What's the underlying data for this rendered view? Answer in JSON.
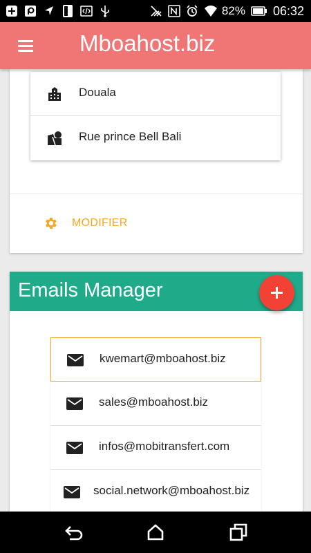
{
  "status_bar": {
    "battery_percent": "82%",
    "time": "06:32",
    "icons": [
      "plus-icon",
      "rounded-square-icon",
      "navigation-icon",
      "phone-icon",
      "code-icon",
      "usb-icon",
      "signal-off-icon",
      "nfc-icon",
      "alarm-icon",
      "wifi-icon",
      "battery-icon"
    ]
  },
  "app_bar": {
    "title": "Mboahost.biz",
    "menu_icon": "menu-icon"
  },
  "address": {
    "items": [
      {
        "icon": "city-icon",
        "label": "Douala"
      },
      {
        "icon": "place-icon",
        "label": "Rue prince Bell Bali"
      }
    ],
    "modify_label": "MODIFIER",
    "modify_icon": "gear-icon",
    "accent_color": "#f5a623"
  },
  "emails_manager": {
    "title": "Emails Manager",
    "header_color": "#1fab89",
    "add_icon": "plus-icon",
    "emails": [
      {
        "address": "kwemart@mboahost.biz",
        "selected": true
      },
      {
        "address": "sales@mboahost.biz",
        "selected": false
      },
      {
        "address": "infos@mobitransfert.com",
        "selected": false
      },
      {
        "address": "social.network@mboahost.biz",
        "selected": false
      }
    ]
  },
  "colors": {
    "app_bar": "#f07676",
    "fab": "#f24236"
  },
  "nav_bar": {
    "icons": [
      "back-icon",
      "home-icon",
      "recents-icon"
    ]
  }
}
